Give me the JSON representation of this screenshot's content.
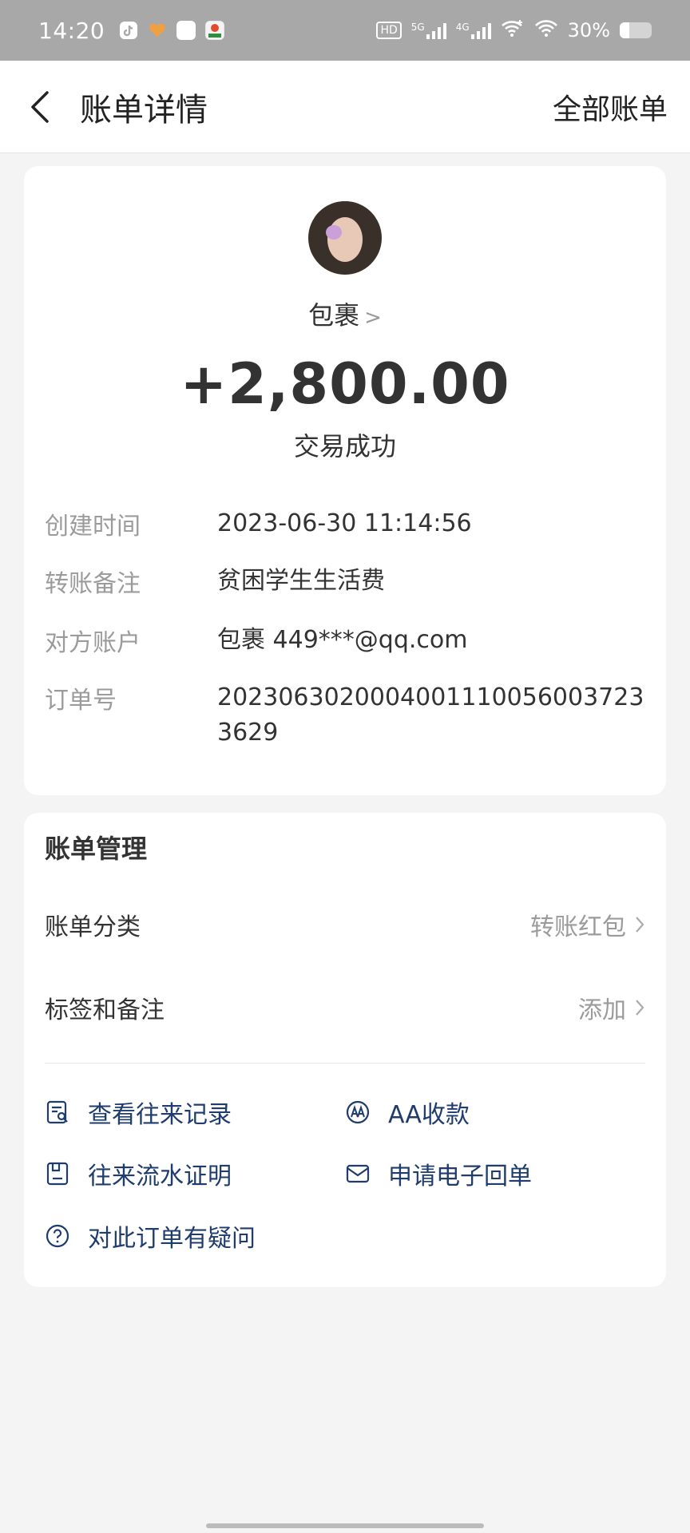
{
  "status_bar": {
    "time": "14:20",
    "hd_label": "HD",
    "sim1_label": "5G",
    "sim2_label": "4G",
    "battery_percent": "30%",
    "battery_level": 0.3
  },
  "nav": {
    "title": "账单详情",
    "right_label": "全部账单",
    "back_icon": "chevron-left-icon"
  },
  "transaction": {
    "counterparty_name": "包裹",
    "amount": "+2,800.00",
    "status": "交易成功",
    "details": [
      {
        "label": "创建时间",
        "value": "2023-06-30 11:14:56"
      },
      {
        "label": "转账备注",
        "value": "贫困学生生活费"
      },
      {
        "label": "对方账户",
        "value": "包裹 449***@qq.com"
      },
      {
        "label": "订单号",
        "value": "20230630200040011100560037233629"
      }
    ]
  },
  "management": {
    "title": "账单管理",
    "rows": [
      {
        "label": "账单分类",
        "value": "转账红包"
      },
      {
        "label": "标签和备注",
        "value": "添加"
      }
    ],
    "actions": [
      {
        "label": "查看往来记录",
        "icon": "record-search-icon"
      },
      {
        "label": "AA收款",
        "icon": "aa-icon"
      },
      {
        "label": "往来流水证明",
        "icon": "document-icon"
      },
      {
        "label": "申请电子回单",
        "icon": "envelope-icon"
      },
      {
        "label": "对此订单有疑问",
        "icon": "question-icon"
      }
    ]
  },
  "colors": {
    "action_text": "#1e3c6e",
    "status_bar_bg": "#a8a8a8",
    "muted_text": "#9b9b9b"
  }
}
